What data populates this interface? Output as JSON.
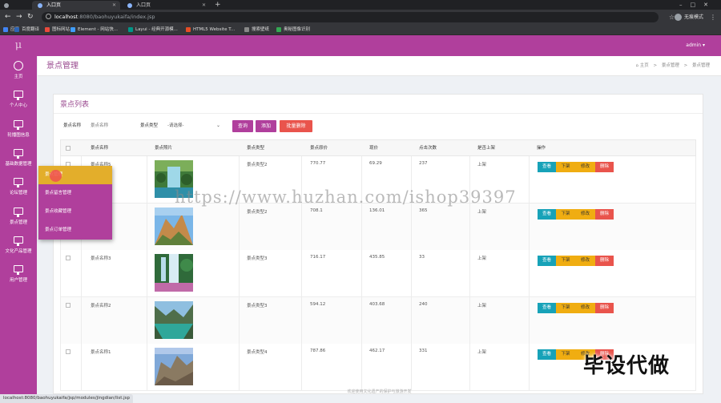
{
  "browser": {
    "tabs": [
      {
        "title": "入口页",
        "active": true
      },
      {
        "title": "入口页",
        "active": false
      }
    ],
    "new_tab": "+",
    "url_host": "localhost",
    "url_rest": ":8080/baohuyukaifa/index.jsp",
    "profile": "无痕模式",
    "bookmarks": [
      {
        "label": "应用",
        "color": "#4285f4"
      },
      {
        "label": "百度翻译",
        "color": "#2d64b3"
      },
      {
        "label": "图标网站",
        "color": "#e84a3c"
      },
      {
        "label": "Element - 网站快...",
        "color": "#409eff"
      },
      {
        "label": "Layui - 经典开源模...",
        "color": "#009688"
      },
      {
        "label": "HTML5 Website T...",
        "color": "#e44d26"
      },
      {
        "label": "搜索壁纸",
        "color": "#888888"
      },
      {
        "label": "奥秘图像识别",
        "color": "#34a853"
      }
    ]
  },
  "app": {
    "logo": "μ",
    "admin": "admin ▾",
    "accent": "#b03f9c",
    "sidebar": [
      {
        "label": "主页",
        "icon": "home-icon"
      },
      {
        "label": "个人中心",
        "icon": "monitor-icon"
      },
      {
        "label": "轮播图信息",
        "icon": "monitor-icon"
      },
      {
        "label": "基础数据管理",
        "icon": "monitor-icon"
      },
      {
        "label": "论坛管理",
        "icon": "monitor-icon"
      },
      {
        "label": "景点管理",
        "icon": "monitor-icon"
      },
      {
        "label": "文化产品管理",
        "icon": "monitor-icon"
      },
      {
        "label": "用户管理",
        "icon": "monitor-icon"
      }
    ],
    "flyout": [
      {
        "label": "景点管理"
      },
      {
        "label": "景点留言管理"
      },
      {
        "label": "景点收藏管理"
      },
      {
        "label": "景点订单管理"
      }
    ],
    "page_title": "景点管理",
    "breadcrumb": [
      "⌂ 主页",
      "景点管理",
      "景点管理"
    ],
    "breadcrumb_sep": ">",
    "card_title": "景点列表",
    "search": {
      "name_label": "景点名称",
      "name_placeholder": "景点名称",
      "type_label": "景点类型",
      "type_value": "-请选择-",
      "query_btn": "查询",
      "add_btn": "添加",
      "batch_delete_btn": "批量删除"
    },
    "table": {
      "headers": [
        "景点名称",
        "景点照片",
        "景点类型",
        "景点原价",
        "现价",
        "点击次数",
        "是否上架",
        "操作"
      ],
      "rows": [
        {
          "name": "景点名称5",
          "type": "景点类型2",
          "orig": "770.77",
          "now": "69.29",
          "clicks": "237",
          "status": "上架",
          "photo": "waterfall"
        },
        {
          "name": "景点名称4",
          "type": "景点类型2",
          "orig": "708.1",
          "now": "136.01",
          "clicks": "365",
          "status": "上架",
          "photo": "mountain"
        },
        {
          "name": "景点名称3",
          "type": "景点类型3",
          "orig": "716.17",
          "now": "435.85",
          "clicks": "33",
          "status": "上架",
          "photo": "falls"
        },
        {
          "name": "景点名称2",
          "type": "景点类型3",
          "orig": "594.12",
          "now": "403.68",
          "clicks": "240",
          "status": "上架",
          "photo": "lake"
        },
        {
          "name": "景点名称1",
          "type": "景点类型4",
          "orig": "787.86",
          "now": "462.17",
          "clicks": "331",
          "status": "上架",
          "photo": "cliff"
        }
      ],
      "ops": {
        "view": "查看",
        "down": "下架",
        "edit": "修改",
        "del": "删除"
      }
    },
    "footer": "欢迎使用文化遗产的保护与旅游开发"
  },
  "overlay": {
    "watermark": "https://www.huzhan.com/ishop39397",
    "brand": "毕设代做"
  },
  "status_url": "localhost:8080/baohuyukaifa/jsp/modules/jingdian/list.jsp"
}
